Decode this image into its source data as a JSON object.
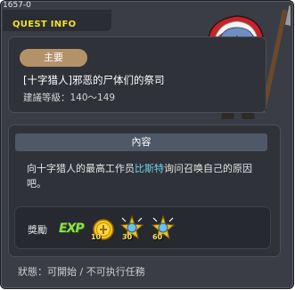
{
  "window": {
    "quest_id": "1657-0",
    "title": "QUEST INFO"
  },
  "main": {
    "badge": "主要",
    "quest_name": "[十字猎人]邪恶的尸体们的祭司",
    "level_range": "建議等級：140～149"
  },
  "content": {
    "header": "內容",
    "desc_part1": "向十字猎人的最高工作员",
    "desc_npc": "比斯特",
    "desc_part2": "询问召唤自己的原因吧。"
  },
  "reward": {
    "label": "獎勵",
    "exp_text": "EXP",
    "items": [
      {
        "icon": "gold-coin-icon",
        "count": "10"
      },
      {
        "icon": "sparkle-badge-icon",
        "count": "30"
      },
      {
        "icon": "sparkle-badge-icon",
        "count": "60"
      }
    ]
  },
  "status": "狀態：可開始 / 不可执行任務",
  "colors": {
    "title": "#f2e227",
    "npc_highlight": "#6fd2f0",
    "badge": "#b3926a",
    "exp": "#8de04a"
  }
}
